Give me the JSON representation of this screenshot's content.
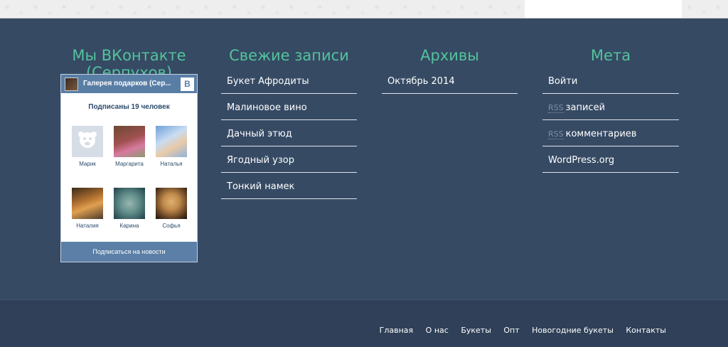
{
  "vk_widget": {
    "heading": "Мы ВКонтакте (Серпухов)",
    "group_title": "Галерея подарков (Сер...",
    "logo": "В",
    "subscribers": "Подписаны 19 человек",
    "members": [
      {
        "name": "Марик"
      },
      {
        "name": "Маргарита"
      },
      {
        "name": "Наталья"
      },
      {
        "name": "Наталия"
      },
      {
        "name": "Карина"
      },
      {
        "name": "Софья"
      }
    ],
    "subscribe_button": "Подписаться на новости"
  },
  "recent_posts": {
    "heading": "Свежие записи",
    "items": [
      "Букет Афродиты",
      "Малиновое вино",
      "Дачный этюд",
      "Ягодный узор",
      "Тонкий намек"
    ]
  },
  "archives": {
    "heading": "Архивы",
    "items": [
      "Октябрь 2014"
    ]
  },
  "meta": {
    "heading": "Мета",
    "login": "Войти",
    "rss_label": "RSS",
    "rss_posts": "записей",
    "rss_comments": "комментариев",
    "wordpress": "WordPress.org"
  },
  "footer_nav": [
    "Главная",
    "О нас",
    "Букеты",
    "Опт",
    "Новогодние букеты",
    "Контакты"
  ],
  "colors": {
    "background": "#364a64",
    "heading": "#53c39b",
    "vk_blue": "#597ea6",
    "footer": "#2f4058"
  }
}
